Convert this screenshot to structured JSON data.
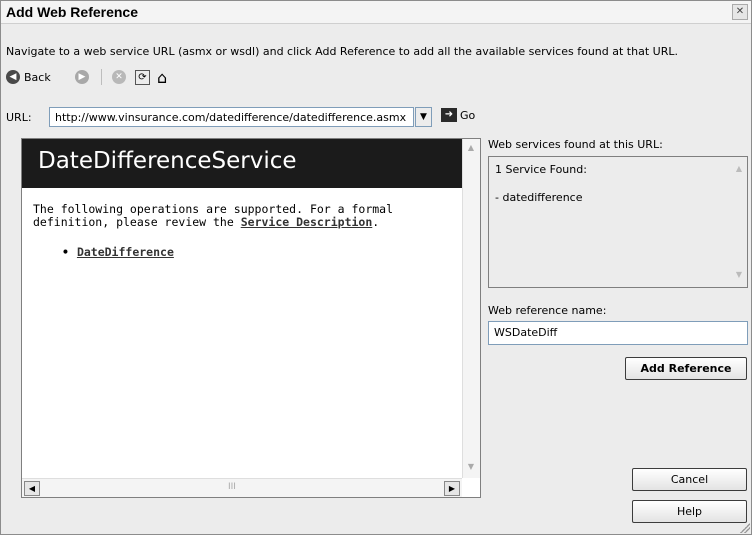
{
  "dialog": {
    "title": "Add Web Reference",
    "close_glyph": "✕",
    "instruction": "Navigate to a web service URL (asmx or wsdl) and click Add Reference to add all the available services found at that URL."
  },
  "toolbar": {
    "back_label": "Back",
    "back_glyph": "◀",
    "forward_glyph": "▶",
    "stop_glyph": "✕",
    "refresh_glyph": "⟳",
    "home_glyph": "⌂"
  },
  "url_bar": {
    "label": "URL:",
    "value": "http://www.vinsurance.com/datedifference/datedifference.asmx",
    "dropdown_glyph": "▼",
    "go_label": "Go",
    "go_glyph": "➜"
  },
  "browser": {
    "page_title": "DateDifferenceService",
    "desc_prefix": "The following operations are supported. For a formal definition, please review the ",
    "service_description_link": "Service Description",
    "desc_suffix": ".",
    "operations": [
      "DateDifference"
    ],
    "scroll_up_glyph": "▲",
    "scroll_down_glyph": "▼",
    "scroll_left_glyph": "◀",
    "scroll_right_glyph": "▶",
    "h_thumb_glyph": "III"
  },
  "services_panel": {
    "label": "Web services found at this URL:",
    "count_text": "1 Service Found:",
    "service_item": "- datedifference"
  },
  "reference_name": {
    "label": "Web reference name:",
    "value": "WSDateDiff"
  },
  "buttons": {
    "add_reference": "Add Reference",
    "cancel": "Cancel",
    "help": "Help"
  }
}
